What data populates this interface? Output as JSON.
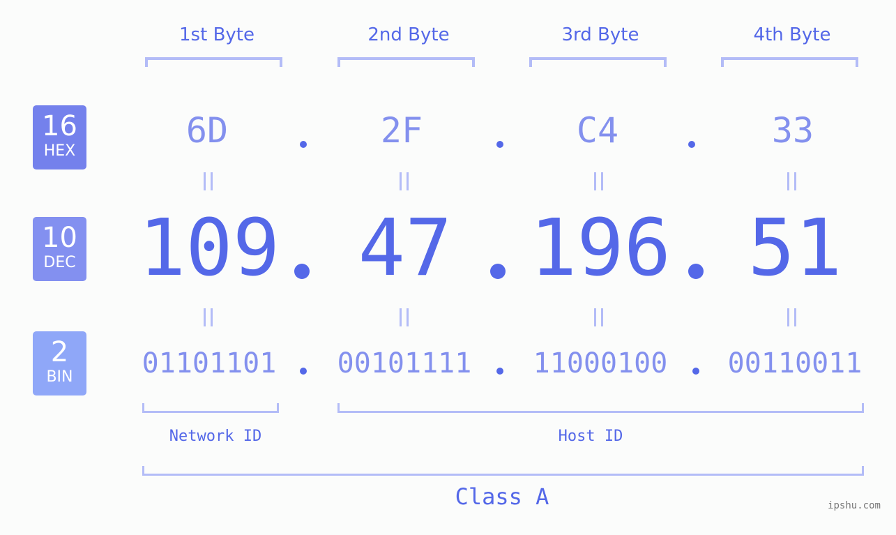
{
  "bases": [
    {
      "number": "16",
      "label": "HEX",
      "color": "#7481ec"
    },
    {
      "number": "10",
      "label": "DEC",
      "color": "#8390f0"
    },
    {
      "number": "2",
      "label": "BIN",
      "color": "#8fa7f8"
    }
  ],
  "byte_labels": [
    "1st Byte",
    "2nd Byte",
    "3rd Byte",
    "4th Byte"
  ],
  "hex": [
    "6D",
    "2F",
    "C4",
    "33"
  ],
  "dec": [
    "109",
    "47",
    "196",
    "51"
  ],
  "bin": [
    "01101101",
    "00101111",
    "11000100",
    "00110011"
  ],
  "separator": ".",
  "network_id_label": "Network ID",
  "host_id_label": "Host ID",
  "class_label": "Class A",
  "watermark": "ipshu.com",
  "colors": {
    "accent": "#5468e8",
    "light": "#8390ee",
    "bracket": "#b3bcf7",
    "background": "#fbfcfb"
  }
}
